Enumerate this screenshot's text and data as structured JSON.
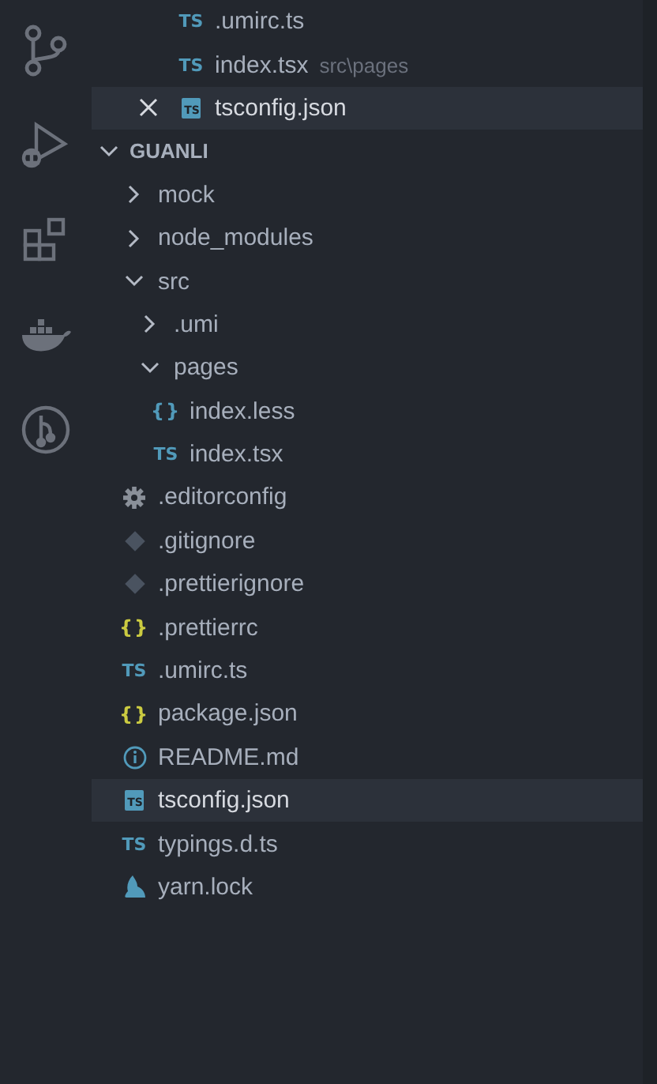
{
  "activity_bar": [
    {
      "kind": "source-control"
    },
    {
      "kind": "run-debug"
    },
    {
      "kind": "extensions"
    },
    {
      "kind": "docker"
    },
    {
      "kind": "git-graph"
    }
  ],
  "open_editors": [
    {
      "name": ".umirc.ts",
      "kind": "ts",
      "glyph": "TS",
      "selected": false
    },
    {
      "name": "index.tsx",
      "description": "src\\pages",
      "kind": "ts",
      "glyph": "TS",
      "selected": false
    },
    {
      "name": "tsconfig.json",
      "kind": "tsconfig",
      "glyph": "TS",
      "selected": true
    }
  ],
  "explorer": {
    "title": "GUANLI",
    "expanded": true,
    "items": [
      {
        "name": "mock",
        "kind": "folder",
        "expanded": false,
        "selected": false
      },
      {
        "name": "node_modules",
        "kind": "folder",
        "expanded": false,
        "selected": false
      },
      {
        "name": "src",
        "kind": "folder",
        "expanded": true,
        "selected": false,
        "children": [
          {
            "name": ".umi",
            "kind": "folder",
            "expanded": false,
            "selected": false
          },
          {
            "name": "pages",
            "kind": "folder",
            "expanded": true,
            "selected": false,
            "children": [
              {
                "name": "index.less",
                "kind": "less",
                "glyph": "{}",
                "selected": false
              },
              {
                "name": "index.tsx",
                "kind": "ts",
                "glyph": "TS",
                "selected": false
              }
            ]
          }
        ]
      },
      {
        "name": ".editorconfig",
        "kind": "gear",
        "selected": false
      },
      {
        "name": ".gitignore",
        "kind": "git",
        "selected": false
      },
      {
        "name": ".prettierignore",
        "kind": "git",
        "selected": false
      },
      {
        "name": ".prettierrc",
        "kind": "json",
        "glyph": "{}",
        "selected": false
      },
      {
        "name": ".umirc.ts",
        "kind": "ts",
        "glyph": "TS",
        "selected": false
      },
      {
        "name": "package.json",
        "kind": "json",
        "glyph": "{}",
        "selected": false
      },
      {
        "name": "README.md",
        "kind": "info",
        "selected": false
      },
      {
        "name": "tsconfig.json",
        "kind": "tsconfig",
        "glyph": "TS",
        "selected": true
      },
      {
        "name": "typings.d.ts",
        "kind": "ts",
        "glyph": "TS",
        "selected": false
      },
      {
        "name": "yarn.lock",
        "kind": "yarn",
        "selected": false
      }
    ]
  }
}
